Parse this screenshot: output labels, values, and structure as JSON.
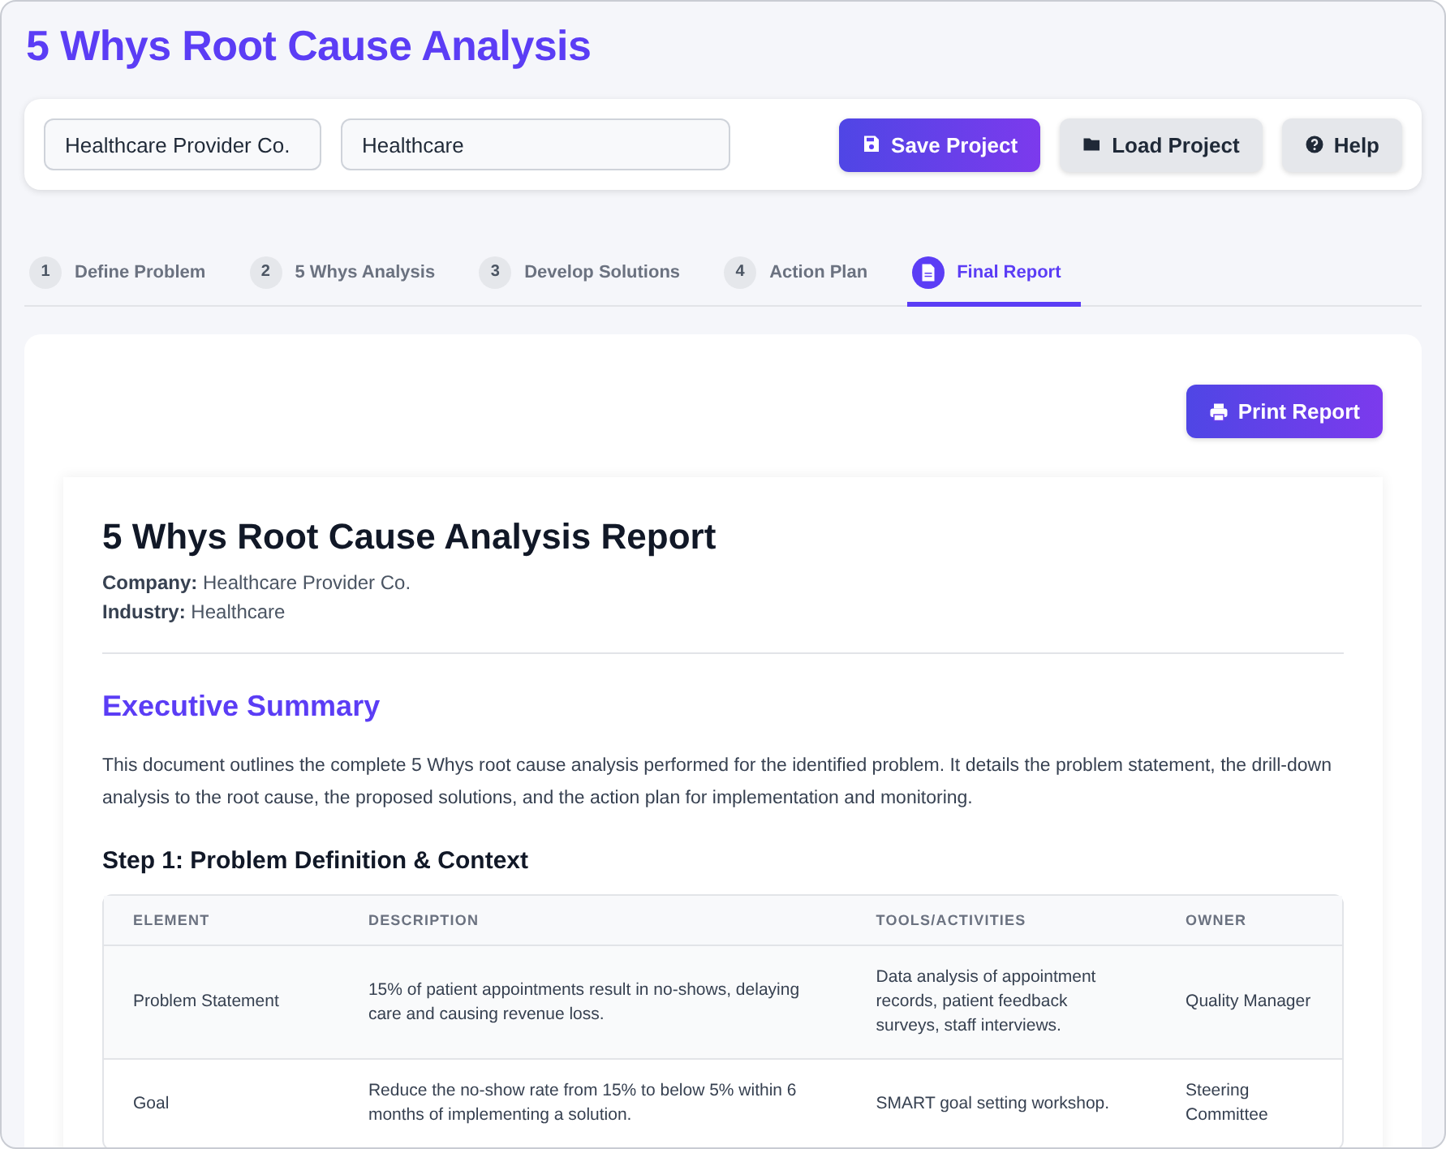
{
  "title": "5 Whys Root Cause Analysis",
  "toolbar": {
    "company": {
      "value": "Healthcare Provider Co."
    },
    "industry": {
      "value": "Healthcare"
    },
    "buttons": [
      {
        "label": "Save Project",
        "kind": "primary"
      },
      {
        "label": "Load Project",
        "kind": "secondary"
      },
      {
        "label": "Help",
        "kind": "secondary"
      }
    ]
  },
  "tabs": [
    {
      "number": "1",
      "label": "Define Problem",
      "selected": false
    },
    {
      "number": "2",
      "label": "5 Whys Analysis",
      "selected": false
    },
    {
      "number": "3",
      "label": "Develop Solutions",
      "selected": false
    },
    {
      "number": "4",
      "label": "Action Plan",
      "selected": false
    },
    {
      "label": "Final Report",
      "selected": true
    }
  ],
  "report": {
    "print_button": "Print Report",
    "heading": "5 Whys Root Cause Analysis Report",
    "meta": [
      "**Company:** Healthcare Provider Co.",
      "**Industry:** Healthcare"
    ],
    "summary_heading": "Executive Summary",
    "summary": "This document outlines the complete 5 Whys root cause analysis performed for the identified problem. It details the problem statement, the drill-down analysis to the root cause, the proposed solutions, and the action plan for implementation and monitoring.",
    "step_heading": "Step 1: Problem Definition & Context",
    "table": {
      "columns": [
        "ELEMENT",
        "DESCRIPTION",
        "TOOLS/ACTIVITIES",
        "OWNER"
      ],
      "rows": [
        [
          "Problem Statement",
          "15% of patient appointments result in no-shows, delaying care and causing revenue loss.",
          "Data analysis of appointment records, patient feedback surveys, staff interviews.",
          "Quality Manager"
        ],
        [
          "Goal",
          "Reduce the no-show rate from 15% to below 5% within 6 months of implementing a solution.",
          "SMART goal setting workshop.",
          "Steering Committee"
        ]
      ]
    }
  }
}
